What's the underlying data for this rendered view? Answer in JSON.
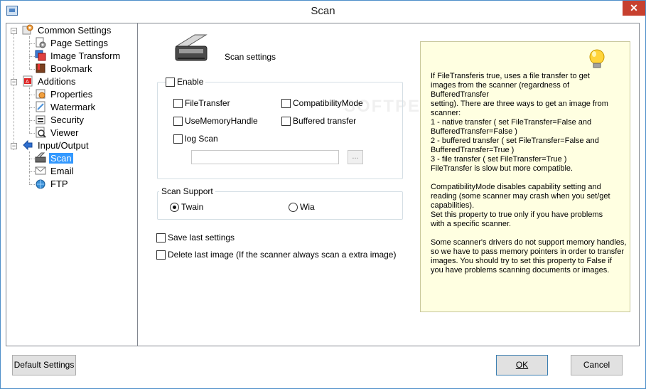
{
  "window": {
    "title": "Scan",
    "close_glyph": "✕"
  },
  "tree": {
    "items": [
      {
        "label": "Common Settings",
        "icon": "settings-icon"
      },
      {
        "label": "Page Settings",
        "icon": "page-settings-icon"
      },
      {
        "label": "Image Transform",
        "icon": "image-transform-icon"
      },
      {
        "label": "Bookmark",
        "icon": "bookmark-icon"
      },
      {
        "label": "Additions",
        "icon": "pdf-icon"
      },
      {
        "label": "Properties",
        "icon": "properties-icon"
      },
      {
        "label": "Watermark",
        "icon": "watermark-icon"
      },
      {
        "label": "Security",
        "icon": "security-icon"
      },
      {
        "label": "Viewer",
        "icon": "viewer-icon"
      },
      {
        "label": "Input/Output",
        "icon": "arrow-icon"
      },
      {
        "label": "Scan",
        "icon": "scanner-icon",
        "selected": true
      },
      {
        "label": "Email",
        "icon": "email-icon"
      },
      {
        "label": "FTP",
        "icon": "ftp-icon"
      }
    ],
    "expander_minus": "−"
  },
  "scan": {
    "header_label": "Scan settings",
    "enable_label": "Enable",
    "file_transfer_label": "FileTransfer",
    "compatibility_mode_label": "CompatibilityMode",
    "use_memory_handle_label": "UseMemoryHandle",
    "buffered_transfer_label": "Buffered transfer",
    "log_scan_label": "log Scan",
    "log_path_value": "",
    "browse_label": "...",
    "scan_support_title": "Scan Support",
    "twain_label": "Twain",
    "wia_label": "Wia",
    "save_last_label": "Save last settings",
    "delete_last_label": "Delete last image (If the scanner always scan a extra image)",
    "watermark_text": "SOFTPEDIA"
  },
  "info": {
    "text": "If FileTransferis true, uses a file transfer to get\nimages from the scanner (regardness of BufferedTransfer\nsetting). There are three ways to get an image from\nscanner:\n1 - native transfer ( set FileTransfer=False and\nBufferedTransfer=False )\n2 - buffered transfer ( set FileTransfer=False and\nBufferedTransfer=True )\n3 - file transfer ( set FileTransfer=True )\nFileTransfer is slow but more compatible.\n\nCompatibilityMode disables capability setting and\nreading (some scanner may crash when you set/get\ncapabilities).\nSet this property to true only if you have problems\nwith a specific scanner.\n\nSome scanner's drivers do not support memory handles,\nso we have to pass memory pointers in order to transfer\nimages. You should try to set this property to False if\nyou have problems scanning documents or images."
  },
  "footer": {
    "default_settings_label": "Default Settings",
    "ok_label": "OK",
    "cancel_label": "Cancel"
  },
  "colors": {
    "selection": "#3399ff",
    "close": "#c7402f",
    "info_bg": "#ffffe1",
    "border": "#4d8fc9"
  }
}
